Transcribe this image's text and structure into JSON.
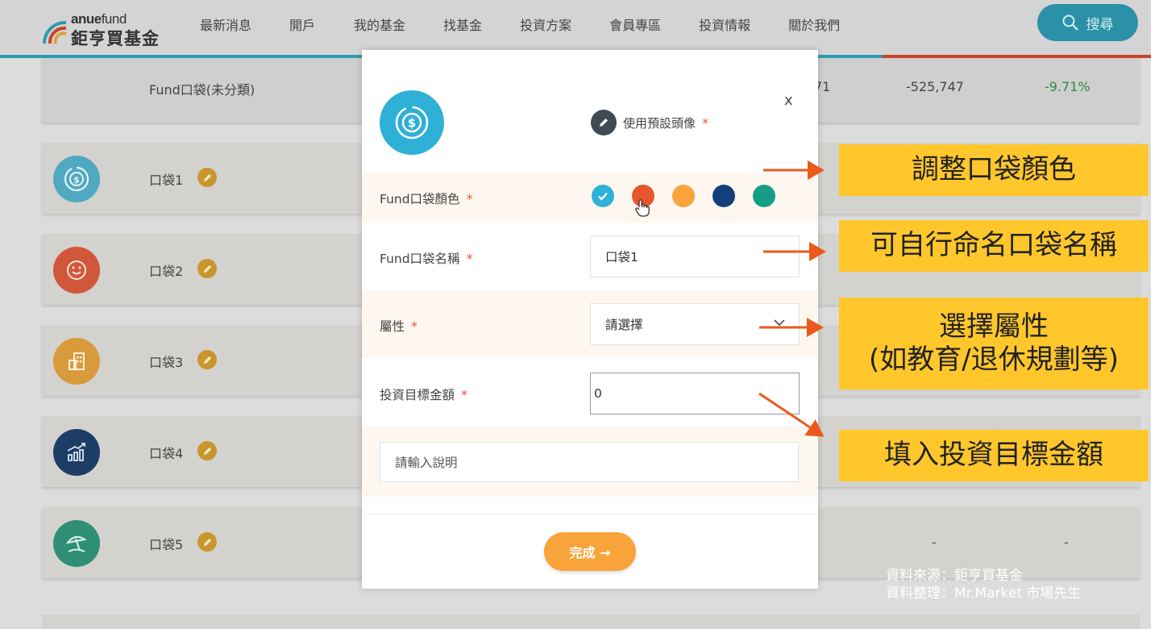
{
  "header": {
    "logo_top_bold": "anue",
    "logo_top_thin": "fund",
    "logo_bottom": "鉅亨買基金",
    "nav": [
      "最新消息",
      "開戶",
      "我的基金",
      "找基金",
      "投資方案",
      "會員專區",
      "投資情報",
      "關於我們"
    ],
    "search_label": "搜尋"
  },
  "fund_row": {
    "label": "Fund口袋(未分類)",
    "value_partial": "71",
    "profit": "-525,747",
    "return_rate": "-9.71%"
  },
  "pockets": [
    {
      "label": "口袋1",
      "color": "#2fb0d6",
      "icon": "dollar-coin-icon"
    },
    {
      "label": "口袋2",
      "color": "#e8552c",
      "icon": "smile-face-icon"
    },
    {
      "label": "口袋3",
      "color": "#f5a623",
      "icon": "building-icon"
    },
    {
      "label": "口袋4",
      "color": "#123f7a",
      "icon": "growth-chart-icon"
    },
    {
      "label": "口袋5",
      "color": "#159e85",
      "icon": "beach-umbrella-icon",
      "dash1": "-",
      "dash2": "-"
    }
  ],
  "modal": {
    "close": "x",
    "default_avatar_label": "使用預設頭像",
    "required_mark": "*",
    "color_label": "Fund口袋顏色",
    "colors": [
      "#2fb0d6",
      "#e8552c",
      "#f8a43a",
      "#153f7a",
      "#159e85"
    ],
    "selected_color": "#2fb0d6",
    "name_label": "Fund口袋名稱",
    "name_value": "口袋1",
    "attr_label": "屬性",
    "attr_value": "請選擇",
    "target_label": "投資目標金額",
    "target_value": "0",
    "desc_placeholder": "請輸入說明",
    "done_label": "完成 →"
  },
  "annotations": {
    "color": "調整口袋顏色",
    "name": "可自行命名口袋名稱",
    "attr_line1": "選擇屬性",
    "attr_line2": "(如教育/退休規劃等)",
    "target": "填入投資目標金額",
    "box_color": "#ffc72b",
    "arrow_color": "#ea5a1c"
  },
  "source": {
    "line1": "資料來源：鉅亨買基金",
    "line2": "資料整理：Mr.Market 市場先生"
  }
}
